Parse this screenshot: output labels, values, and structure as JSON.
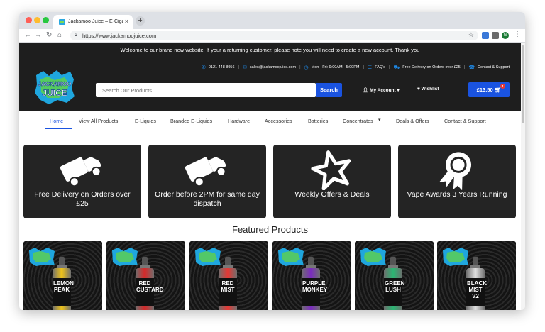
{
  "browser": {
    "tab_title": "Jackamoo Juice – E-Cigarette",
    "tab_close": "×",
    "new_tab": "+",
    "url": "https://www.jackamoojuice.com",
    "profile_initial": "G"
  },
  "site": {
    "announcement": "Welcome to our brand new website. If your a returning customer, please note you will need to create a new account. Thank you",
    "contact": {
      "phone": "0121 448 8956",
      "email": "sales@jackamoojuice.com",
      "hours": "Mon - Fri: 9:00AM - 5:00PM",
      "faqs": "FAQ's",
      "delivery": "Free Delivery on Orders over £25",
      "support": "Contact & Support"
    },
    "logo": {
      "line1": "JACKAMOO",
      "line2": "JUICE"
    },
    "search_placeholder": "Search Our Products",
    "search_button": "Search",
    "account": "My Account",
    "wishlist": "Wishlist",
    "cart_total": "£13.50",
    "cart_count": "1"
  },
  "nav": {
    "items": [
      "Home",
      "View All Products",
      "E-Liquids",
      "Branded E-Liquids",
      "Hardware",
      "Accessories",
      "Batteries",
      "Concentrates",
      "Deals & Offers",
      "Contact & Support"
    ]
  },
  "features": [
    {
      "text": "Free Delivery on Orders over £25",
      "icon": "truck-icon"
    },
    {
      "text": "Order before 2PM for same day dispatch",
      "icon": "truck-icon"
    },
    {
      "text": "Weekly Offers & Deals",
      "icon": "star-icon"
    },
    {
      "text": "Vape Awards 3 Years Running",
      "icon": "award-icon"
    }
  ],
  "featured_title": "Featured Products",
  "products": [
    {
      "label": "LEMON PEAK",
      "color": "#f0c419"
    },
    {
      "label": "RED CUSTARD",
      "color": "#d62828"
    },
    {
      "label": "RED MIST",
      "color": "#e53935"
    },
    {
      "label": "PURPLE MONKEY",
      "color": "#7b2cbf"
    },
    {
      "label": "GREEN LUSH",
      "color": "#2bb673"
    },
    {
      "label": "BLACK MIST V2",
      "color": "#e0e0e0"
    }
  ],
  "colors": {
    "accent": "#1a53e0",
    "header_bg": "#1e1e1e"
  }
}
